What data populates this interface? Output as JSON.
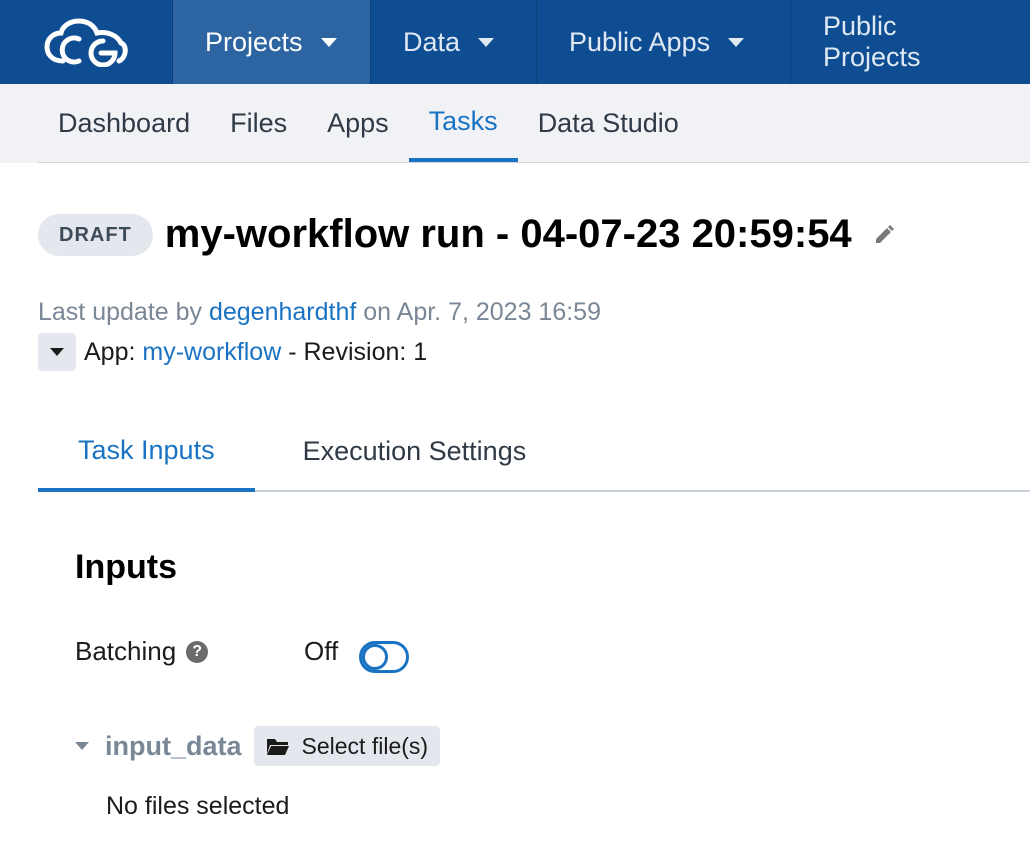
{
  "topnav": {
    "items": [
      {
        "label": "Projects",
        "has_caret": true
      },
      {
        "label": "Data",
        "has_caret": true
      },
      {
        "label": "Public Apps",
        "has_caret": true
      },
      {
        "label": "Public Projects",
        "has_caret": false
      }
    ],
    "active_index": 0,
    "logo_icon": "cloud-logo-icon"
  },
  "subnav": {
    "items": [
      {
        "label": "Dashboard"
      },
      {
        "label": "Files"
      },
      {
        "label": "Apps"
      },
      {
        "label": "Tasks"
      },
      {
        "label": "Data Studio"
      }
    ],
    "active_index": 3
  },
  "task": {
    "status_badge": "DRAFT",
    "title": "my-workflow run - 04-07-23 20:59:54",
    "meta": {
      "prefix": "Last update by ",
      "user": "degenhardthf",
      "on_text": " on Apr. 7, 2023 16:59"
    },
    "app": {
      "prefix": "App: ",
      "name": "my-workflow",
      "revision_text": " - Revision: 1"
    }
  },
  "tabs": [
    {
      "label": "Task Inputs"
    },
    {
      "label": "Execution Settings"
    }
  ],
  "inputs": {
    "heading": "Inputs",
    "batching_label": "Batching",
    "batching_value": "Off",
    "input_name": "input_data",
    "select_button": "Select file(s)",
    "empty_text": "No files selected"
  },
  "colors": {
    "nav_bg": "#0f4d92",
    "nav_active": "#2d64a2",
    "accent": "#1a73c2",
    "muted": "#7a8796"
  }
}
